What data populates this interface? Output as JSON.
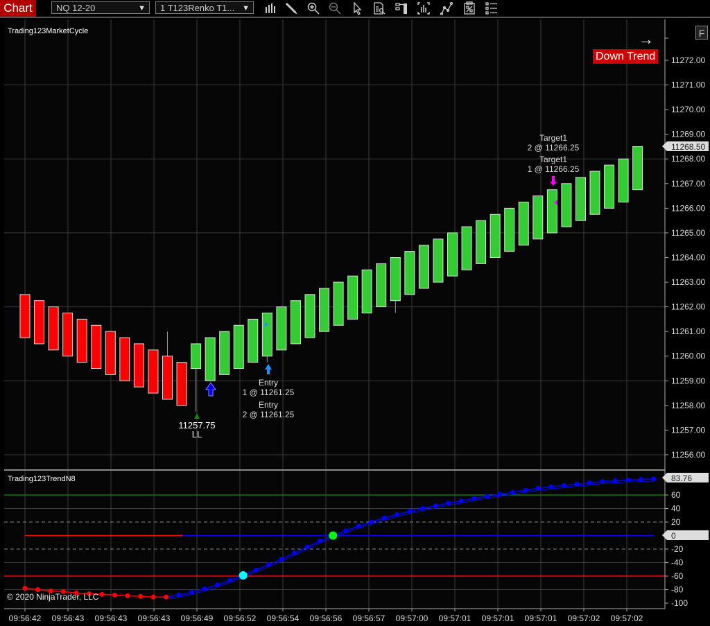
{
  "toolbar": {
    "tab_label": "Chart",
    "instrument": "NQ 12-20",
    "interval": "1 T123Renko T1...",
    "icons": [
      "bar-type-icon",
      "pencil-icon",
      "zoom-in-icon",
      "zoom-out-icon",
      "pointer-icon",
      "data-box-icon",
      "properties-icon",
      "chart-style-icon",
      "strategy-icon",
      "template-icon",
      "indicator-list-icon"
    ]
  },
  "price_panel": {
    "title": "Trading123MarketCycle",
    "trend_badge": "Down Trend",
    "trend_arrow": "→",
    "f_button": "F",
    "axis_ticks": [
      "11272.00",
      "11271.00",
      "11270.00",
      "11269.00",
      "11268.00",
      "11267.00",
      "11266.00",
      "11265.00",
      "11264.00",
      "11263.00",
      "11262.00",
      "11261.00",
      "11260.00",
      "11259.00",
      "11258.00",
      "11257.00",
      "11256.00"
    ],
    "last_price": "11268.50",
    "annotations": {
      "ll_price": "11257.75",
      "ll_label": "LL",
      "entry1_label": "Entry",
      "entry1_detail": "1 @ 11261.25",
      "entry2_label": "Entry",
      "entry2_detail": "2 @ 11261.25",
      "target2_label": "Target1",
      "target2_detail": "2 @ 11266.25",
      "target1_label": "Target1",
      "target1_detail": "1 @ 11266.25"
    }
  },
  "indicator_panel": {
    "title": "Trading123TrendN8",
    "axis_ticks": [
      "60",
      "40",
      "20",
      "-20",
      "-40",
      "-60",
      "-80",
      "-100"
    ],
    "last_value": "83.76",
    "zero_marker": "0"
  },
  "x_axis": {
    "labels": [
      "09:56:42",
      "09:56:43",
      "09:56:43",
      "09:56:43",
      "09:56:49",
      "09:56:52",
      "09:56:54",
      "09:56:56",
      "09:56:57",
      "09:57:00",
      "09:57:01",
      "09:57:01",
      "09:57:01",
      "09:57:02",
      "09:57:02"
    ]
  },
  "copyright": "© 2020 NinjaTrader, LLC",
  "colors": {
    "down": "#ff0000",
    "up": "#33cc33",
    "indicator_line": "#0000ff",
    "upper_level": "#008000",
    "lower_level": "#ff0000",
    "target_marker": "#ff00ff",
    "entry_marker": "#1e90ff",
    "trend_badge": "#d00000"
  },
  "chart_data": {
    "type": "candlestick",
    "title": "NQ 12-20 1 T123Renko",
    "ylim": [
      11255.6,
      11272.9
    ],
    "bars": [
      {
        "dir": "down",
        "open": 11262.5,
        "close": 11260.75
      },
      {
        "dir": "down",
        "open": 11262.25,
        "close": 11260.5
      },
      {
        "dir": "down",
        "open": 11262.0,
        "close": 11260.25
      },
      {
        "dir": "down",
        "open": 11261.75,
        "close": 11260.0
      },
      {
        "dir": "down",
        "open": 11261.5,
        "close": 11259.75
      },
      {
        "dir": "down",
        "open": 11261.25,
        "close": 11259.5
      },
      {
        "dir": "down",
        "open": 11261.0,
        "close": 11259.25
      },
      {
        "dir": "down",
        "open": 11260.75,
        "close": 11259.0
      },
      {
        "dir": "down",
        "open": 11260.5,
        "close": 11258.75
      },
      {
        "dir": "down",
        "open": 11260.25,
        "close": 11258.5
      },
      {
        "dir": "down",
        "open": 11260.0,
        "close": 11258.25,
        "high": 11261.0
      },
      {
        "dir": "down",
        "open": 11259.75,
        "close": 11258.0
      },
      {
        "dir": "up",
        "open": 11259.5,
        "close": 11260.5,
        "low": 11257.75
      },
      {
        "dir": "up",
        "open": 11259.0,
        "close": 11260.75
      },
      {
        "dir": "up",
        "open": 11259.25,
        "close": 11261.0
      },
      {
        "dir": "up",
        "open": 11259.5,
        "close": 11261.25
      },
      {
        "dir": "up",
        "open": 11259.75,
        "close": 11261.5
      },
      {
        "dir": "up",
        "open": 11260.0,
        "close": 11261.75,
        "low": 11259.75
      },
      {
        "dir": "up",
        "open": 11260.25,
        "close": 11262.0
      },
      {
        "dir": "up",
        "open": 11260.5,
        "close": 11262.25
      },
      {
        "dir": "up",
        "open": 11260.75,
        "close": 11262.5
      },
      {
        "dir": "up",
        "open": 11261.0,
        "close": 11262.75
      },
      {
        "dir": "up",
        "open": 11261.25,
        "close": 11263.0
      },
      {
        "dir": "up",
        "open": 11261.5,
        "close": 11263.25
      },
      {
        "dir": "up",
        "open": 11261.75,
        "close": 11263.5
      },
      {
        "dir": "up",
        "open": 11262.0,
        "close": 11263.75
      },
      {
        "dir": "up",
        "open": 11262.25,
        "close": 11264.0,
        "low": 11261.75
      },
      {
        "dir": "up",
        "open": 11262.5,
        "close": 11264.25
      },
      {
        "dir": "up",
        "open": 11262.75,
        "close": 11264.5
      },
      {
        "dir": "up",
        "open": 11263.0,
        "close": 11264.75
      },
      {
        "dir": "up",
        "open": 11263.25,
        "close": 11265.0
      },
      {
        "dir": "up",
        "open": 11263.5,
        "close": 11265.25
      },
      {
        "dir": "up",
        "open": 11263.75,
        "close": 11265.5
      },
      {
        "dir": "up",
        "open": 11264.0,
        "close": 11265.75
      },
      {
        "dir": "up",
        "open": 11264.25,
        "close": 11266.0
      },
      {
        "dir": "up",
        "open": 11264.5,
        "close": 11266.25
      },
      {
        "dir": "up",
        "open": 11264.75,
        "close": 11266.5
      },
      {
        "dir": "up",
        "open": 11265.0,
        "close": 11266.75
      },
      {
        "dir": "up",
        "open": 11265.25,
        "close": 11267.0
      },
      {
        "dir": "up",
        "open": 11265.5,
        "close": 11267.25
      },
      {
        "dir": "up",
        "open": 11265.75,
        "close": 11267.5
      },
      {
        "dir": "up",
        "open": 11266.0,
        "close": 11267.75
      },
      {
        "dir": "up",
        "open": 11266.25,
        "close": 11268.0
      },
      {
        "dir": "up",
        "open": 11266.75,
        "close": 11268.5
      }
    ],
    "indicator": {
      "name": "Trading123TrendN8",
      "ylim": [
        -105,
        90
      ],
      "levels": {
        "upper": 60,
        "upper_dash": 20,
        "zero": 0,
        "lower_dash": -20,
        "lower": -60
      },
      "values": [
        -78,
        -80,
        -82,
        -83,
        -85,
        -86,
        -87,
        -88,
        -89,
        -90,
        -91,
        -91,
        -88,
        -84,
        -79,
        -73,
        -66,
        -59,
        -51,
        -43,
        -35,
        -26,
        -17,
        -8,
        0,
        7,
        14,
        20,
        26,
        31,
        36,
        40,
        44,
        48,
        51,
        55,
        58,
        61,
        64,
        67,
        70,
        72,
        74,
        76,
        78,
        80,
        81,
        82,
        83,
        83.76
      ]
    }
  }
}
